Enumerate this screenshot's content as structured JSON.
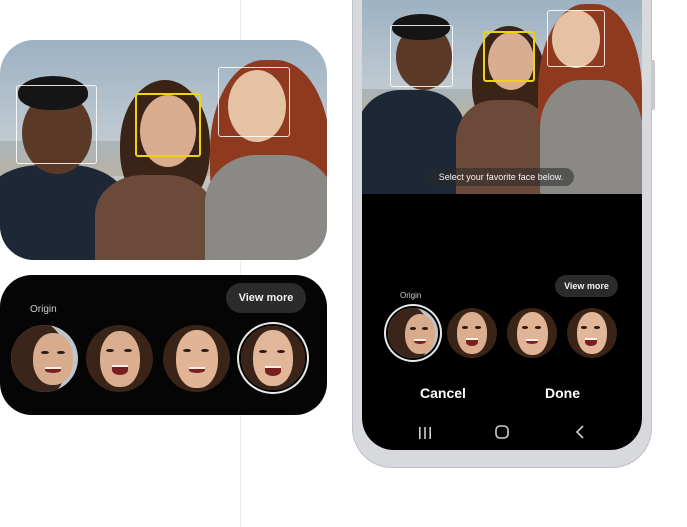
{
  "zoom_panel": {
    "view_more_label": "View more",
    "origin_label": "Origin"
  },
  "phone": {
    "toast_text": "Select your favorite face below.",
    "view_more_label": "View more",
    "origin_label": "Origin",
    "cancel_label": "Cancel",
    "done_label": "Done",
    "nav": {
      "recents_icon": "recents-icon",
      "home_icon": "home-icon",
      "back_icon": "back-icon"
    }
  },
  "colors": {
    "selection_box": "#f2d10e",
    "background": "#000000",
    "pill": "#2b2b2b"
  }
}
